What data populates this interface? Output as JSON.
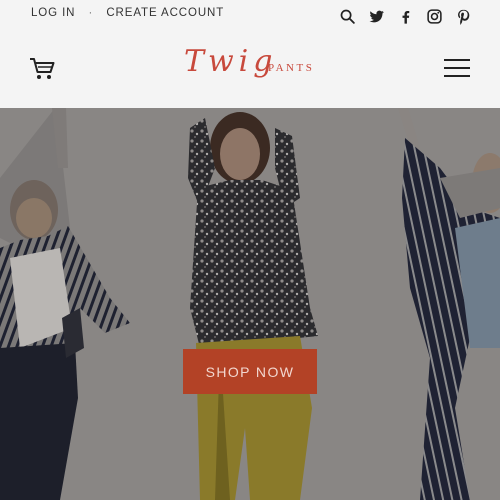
{
  "header": {
    "top_links": {
      "login": "LOG IN",
      "separator": "·",
      "create_account": "CREATE ACCOUNT"
    },
    "icons": [
      "search-icon",
      "twitter-icon",
      "facebook-icon",
      "instagram-icon",
      "pinterest-icon",
      "cart-icon",
      "hamburger-menu-icon"
    ],
    "logo": {
      "script": "Twig",
      "sub": "PANTS"
    }
  },
  "hero": {
    "cta_label": "SHOP NOW",
    "colors": {
      "cta": "#b34226",
      "logo": "#c8493c"
    }
  }
}
